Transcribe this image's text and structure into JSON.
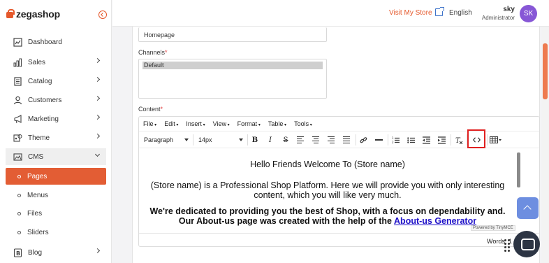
{
  "brand": {
    "name": "zegashop"
  },
  "sidebar": {
    "items": [
      {
        "label": "Dashboard",
        "icon": "dashboard-icon"
      },
      {
        "label": "Sales",
        "icon": "bar-chart-icon"
      },
      {
        "label": "Catalog",
        "icon": "catalog-icon"
      },
      {
        "label": "Customers",
        "icon": "user-icon"
      },
      {
        "label": "Marketing",
        "icon": "megaphone-icon"
      },
      {
        "label": "Theme",
        "icon": "palette-icon"
      },
      {
        "label": "CMS",
        "icon": "cms-icon"
      },
      {
        "label": "Blog",
        "icon": "blog-icon"
      }
    ],
    "cms_sub": [
      "Pages",
      "Menus",
      "Files",
      "Sliders"
    ]
  },
  "header": {
    "visit_store": "Visit My Store",
    "language": "English",
    "user_name": "sky",
    "user_role": "Administrator",
    "avatar_initials": "SK"
  },
  "form": {
    "page_value": "Homepage",
    "channels_label": "Channels",
    "channels_selected": "Default",
    "content_label": "Content",
    "required_mark": "*"
  },
  "editor": {
    "menu": [
      "File",
      "Edit",
      "Insert",
      "View",
      "Format",
      "Table",
      "Tools"
    ],
    "block_format": "Paragraph",
    "font_size": "14px",
    "para1": "Hello Friends Welcome To (Store name)",
    "para2": "(Store name) is a Professional Shop Platform. Here we will provide you with only interesting content, which you will like very much.",
    "para3_text": "We're dedicated to providing you the best of Shop, with a focus on dependability and. Our About-us page was created with the help of the",
    "para3_link": "About-us Generator",
    "powered_by": "Powered by TinyMCE",
    "words_label": "Words: 1"
  },
  "colors": {
    "accent": "#e35d34",
    "avatar": "#8757d6",
    "link": "#1e10c8",
    "highlight": "#e02020"
  }
}
